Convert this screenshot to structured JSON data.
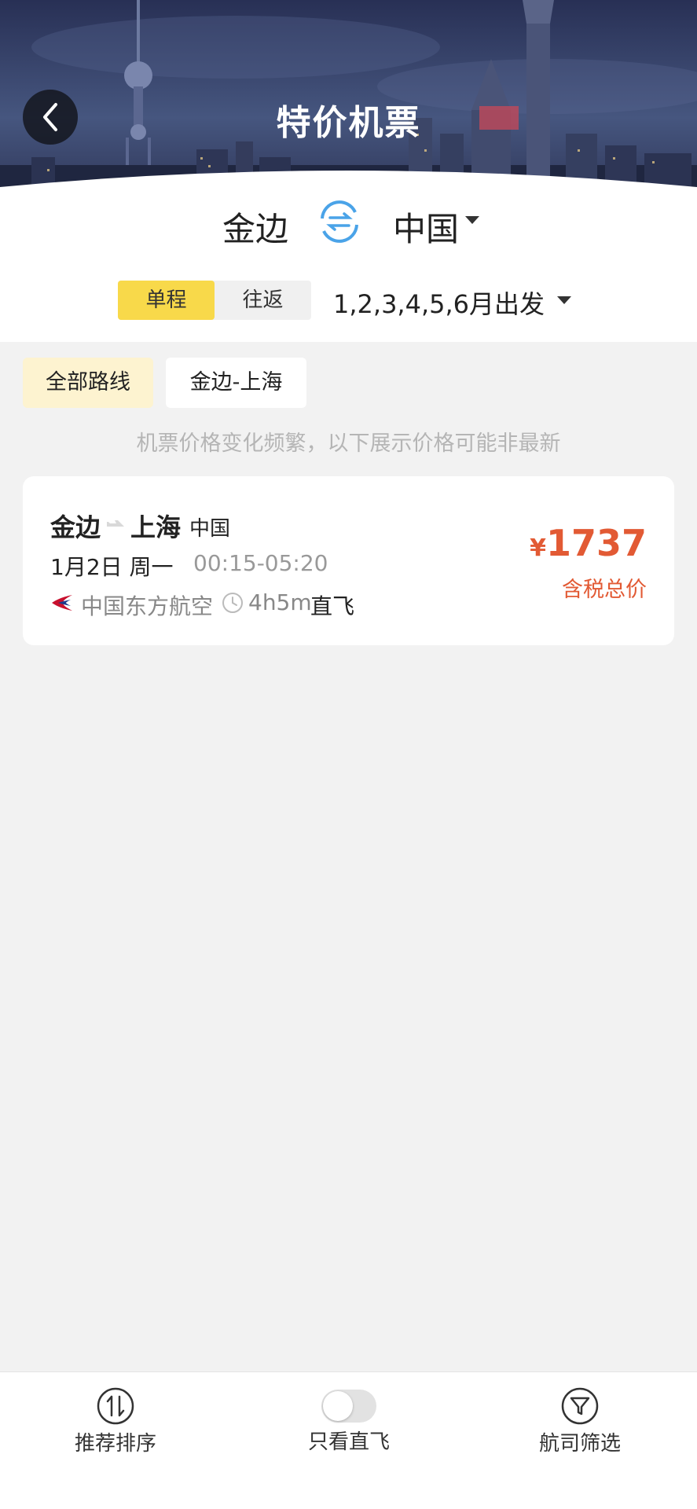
{
  "header": {
    "title": "特价机票",
    "back_icon": "chevron-left-icon"
  },
  "route": {
    "from": "金边",
    "to": "中国",
    "swap_icon": "swap-arrows-icon"
  },
  "trip_type": {
    "options": [
      "单程",
      "往返"
    ],
    "selected": "单程"
  },
  "departure_months": "1,2,3,4,5,6月出发",
  "filters": {
    "chips": [
      "全部路线",
      "金边-上海"
    ],
    "selected": "全部路线"
  },
  "notice": "机票价格变化频繁，以下展示价格可能非最新",
  "flights": [
    {
      "from": "金边",
      "to": "上海",
      "country": "中国",
      "date": "1月2日 周一",
      "time": "00:15-05:20",
      "airline": "中国东方航空",
      "duration": "4h5m",
      "stops": "直飞",
      "currency": "¥",
      "price": "1737",
      "price_note": "含税总价"
    }
  ],
  "bottom_bar": {
    "sort_label": "推荐排序",
    "direct_label": "只看直飞",
    "direct_only": false,
    "airline_filter_label": "航司筛选"
  },
  "colors": {
    "accent_yellow": "#f8d94a",
    "chip_active_bg": "#fdf3d0",
    "price_red": "#e25a34",
    "swap_blue": "#4aa3e8"
  }
}
